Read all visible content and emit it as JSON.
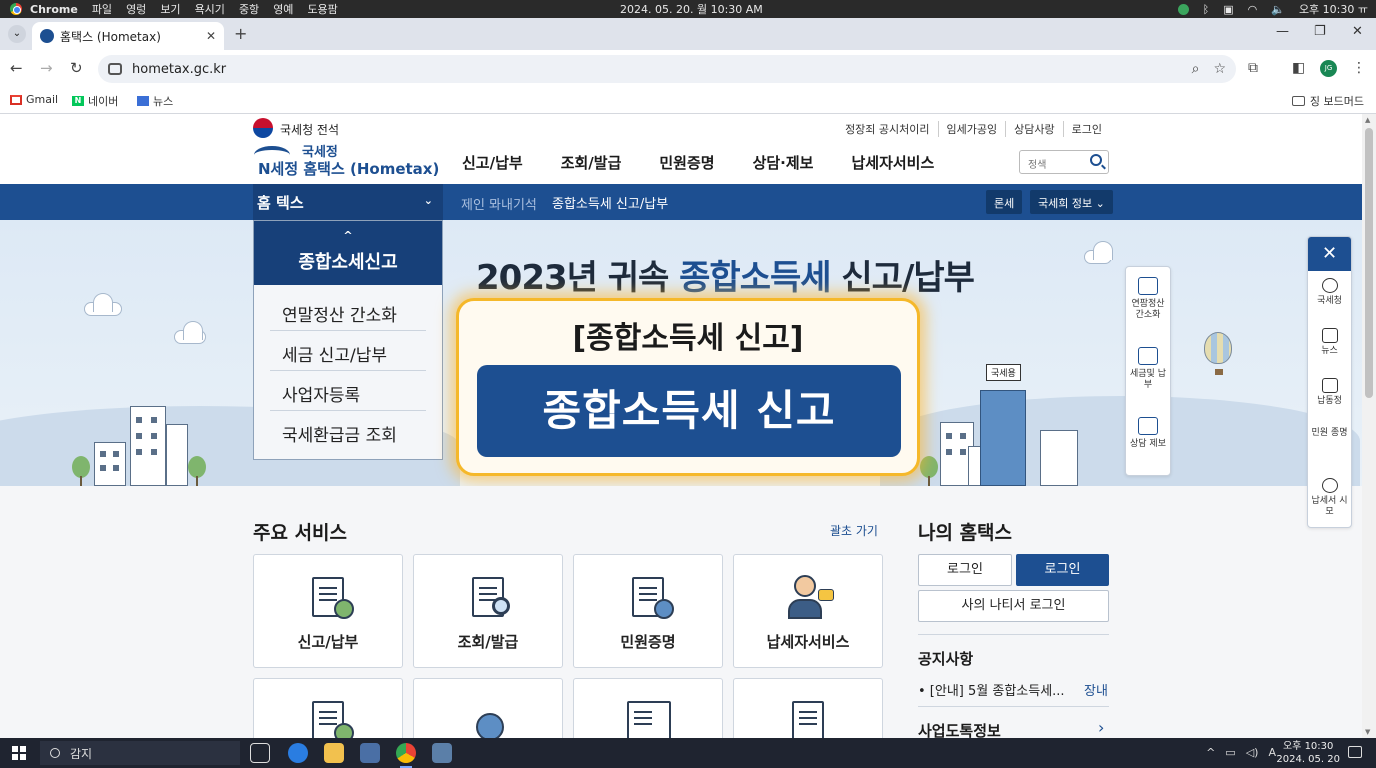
{
  "os_menubar": {
    "app_name": "Chrome",
    "menu": [
      "파일",
      "영렁",
      "보기",
      "욕시기",
      "중항",
      "영예",
      "도용팜"
    ],
    "datetime": "2024. 05. 20. 월 10:30 AM",
    "clock_right": "오후 10:30 ㅠ"
  },
  "browser": {
    "tab_title": "홈택스 (Hometax)",
    "url": "hometax.gc.kr",
    "profile_initials": "JG",
    "bookmarks": [
      {
        "label": "Gmail",
        "icon": "gmail-icon"
      },
      {
        "label": "네이버",
        "icon": "naver-icon"
      },
      {
        "label": "뉴스",
        "icon": "news-icon"
      }
    ],
    "bookmarks_right": "징 보드머드"
  },
  "site": {
    "agency": "국세청 전석",
    "util_links": [
      "정장죄 공시처이리",
      "임세가공잉",
      "상담사랑",
      "로그인"
    ],
    "logo_line1": "국세정",
    "logo_line2": "N세정 홈택스 (Hometax)",
    "gnb": [
      "신고/납부",
      "조회/발급",
      "민원증명",
      "상담·제보",
      "납세자서비스"
    ],
    "search_placeholder": "정색"
  },
  "location_bar": {
    "home": "홈 텍스",
    "crumb1": "제인 뫄내기석",
    "crumb2": "종합소득세 신고/납부",
    "buttons": [
      "론세",
      "국세희 정보 ⌄"
    ]
  },
  "side_menu": {
    "heading": "종합소세신고",
    "items": [
      "연말정산 간소화",
      "세금 신고/납부",
      "사업자등록",
      "국세환급금 조회"
    ]
  },
  "hero": {
    "title_prefix": "2023년 귀속 ",
    "title_highlight": "종합소득세",
    "title_suffix": " 신고/납부",
    "building_sign": "국세용"
  },
  "callout": {
    "label": "[종합소득세 신고]",
    "button": "종합소득세 신고"
  },
  "quick_menu_left": [
    {
      "label": "연팜정산 간소화",
      "icon": "receipt-icon"
    },
    {
      "label": "세금및 납부",
      "icon": "tax-doc-icon"
    },
    {
      "label": "상담 제보",
      "icon": "chat-icon"
    }
  ],
  "quick_menu_right": [
    {
      "label": "국세청",
      "icon": "globe-icon"
    },
    {
      "label": "뉴스",
      "icon": "news-icon"
    },
    {
      "label": "납동정",
      "icon": "document-icon"
    },
    {
      "label": "민원 종명",
      "icon": "certificate-icon"
    },
    {
      "label": "납세서 시모",
      "icon": "speech-bubble-icon"
    }
  ],
  "main_services": {
    "title": "주요 서비스",
    "more": "괄초 가기",
    "cards": [
      {
        "label": "신고/납부",
        "icon": "report-payment-icon"
      },
      {
        "label": "조회/발급",
        "icon": "lookup-issue-icon"
      },
      {
        "label": "민원증명",
        "icon": "certificate-icon"
      },
      {
        "label": "납세자서비스",
        "icon": "taxpayer-service-icon"
      }
    ],
    "row2_icons": [
      "clipboard-person-icon",
      "globe-question-icon",
      "coin-browser-icon",
      "id-card-pen-icon"
    ]
  },
  "my_hometax": {
    "title": "나의 홈택스",
    "login_ghost": "로그인",
    "login_solid": "로그인",
    "cert_login": "사의 나티서 로그인",
    "notice_title": "공지사항",
    "notice_item": "• [안내] 5월 종합소득세...",
    "notice_more": "장내",
    "biz_title": "사업도톡정보"
  },
  "taskbar": {
    "search_text": "감지",
    "clock_time": "오후 10:30",
    "clock_date": "2024. 05. 20"
  },
  "colors": {
    "brand_blue": "#1d4f91",
    "callout_glow": "#f5b82a"
  }
}
